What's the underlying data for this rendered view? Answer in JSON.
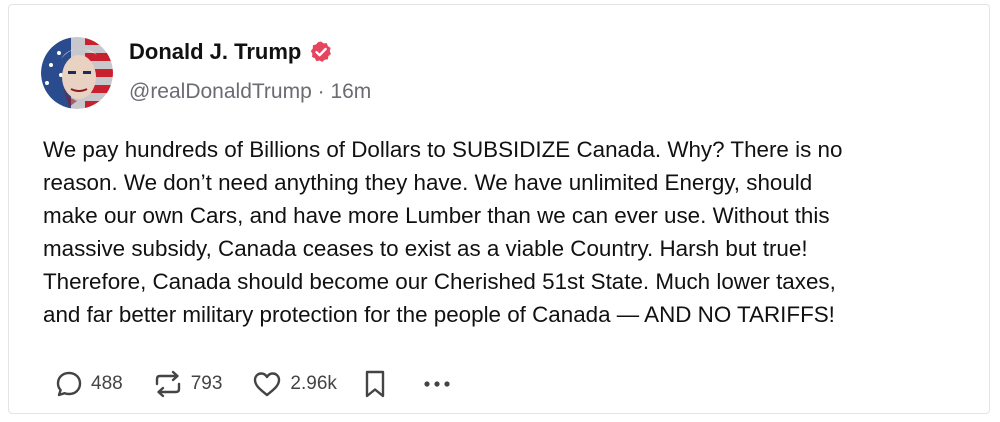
{
  "post": {
    "author_name": "Donald J. Trump",
    "handle": "@realDonaldTrump",
    "separator": " · ",
    "time_ago": "16m",
    "verified": true,
    "text": "We pay hundreds of Billions of Dollars to SUBSIDIZE Canada. Why? There is no\nreason. We don’t need anything they have. We have unlimited Energy, should\nmake our own Cars, and have more Lumber than we can ever use. Without this\nmassive subsidy, Canada ceases to exist as a viable Country. Harsh but true!\nTherefore, Canada should become our Cherished 51st State. Much lower taxes,\nand far better military protection for the people of Canada — AND NO TARIFFS!"
  },
  "actions": {
    "replies": "488",
    "reposts": "793",
    "likes": "2.96k"
  },
  "icons": {
    "verified": "verified-badge-icon",
    "reply": "reply-icon",
    "repost": "repost-icon",
    "like": "heart-icon",
    "bookmark": "bookmark-icon",
    "more": "more-options-icon"
  },
  "colors": {
    "verified_badge": "#e5455d",
    "text_primary": "#111111",
    "text_secondary": "#6b6b73",
    "icon": "#444444"
  }
}
